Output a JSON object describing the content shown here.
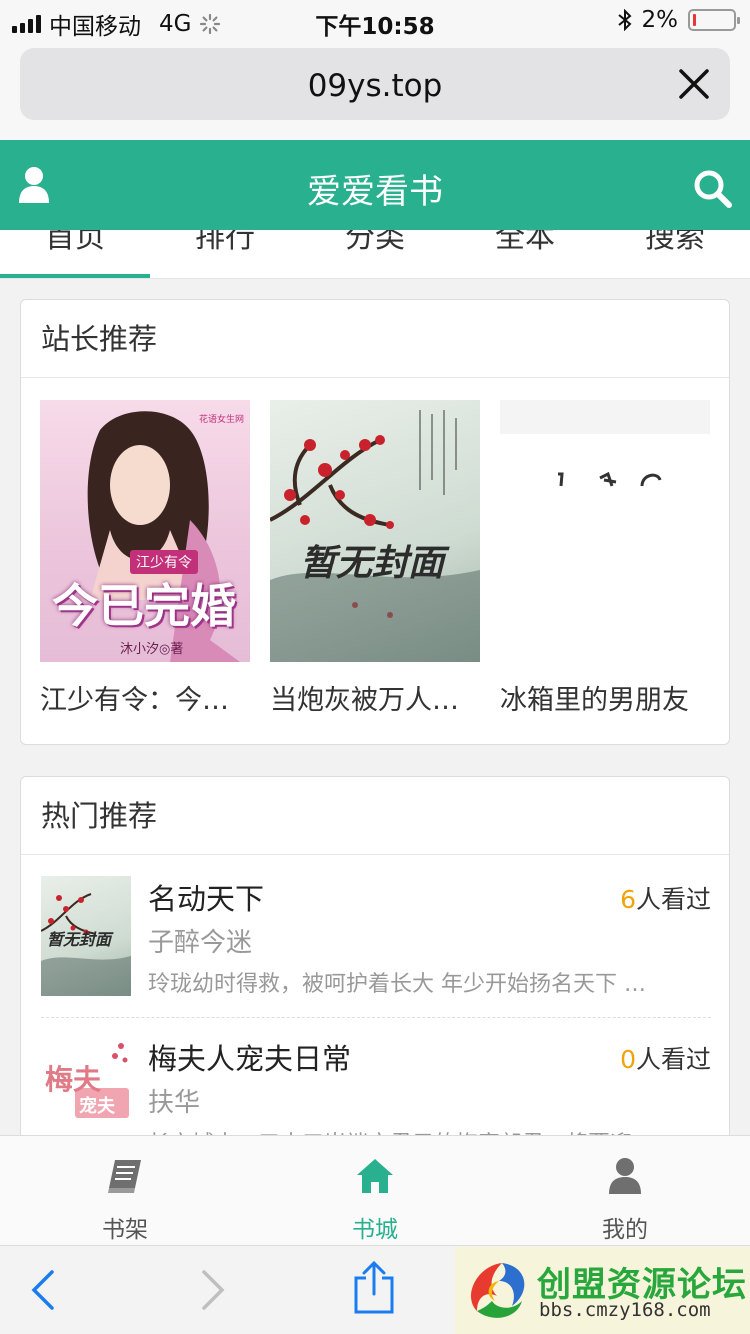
{
  "status_bar": {
    "carrier": "中国移动",
    "network": "4G",
    "time": "下午10:58",
    "battery": "2%"
  },
  "browser": {
    "url": "09ys.top"
  },
  "header": {
    "title": "爱爱看书"
  },
  "tabs": [
    {
      "label": "首页"
    },
    {
      "label": "排行"
    },
    {
      "label": "分类"
    },
    {
      "label": "全本"
    },
    {
      "label": "搜索"
    }
  ],
  "recommend": {
    "title": "站长推荐",
    "books": [
      {
        "name": "江少有令：今…",
        "cover_title": "今已完婚",
        "cover_subtitle": "江少有令",
        "cover_author": "沐小汐◎著",
        "cover_badge": "花语女生网"
      },
      {
        "name": "当炮灰被万人…",
        "cover_text": "暂无封面"
      },
      {
        "name": "冰箱里的男朋友"
      }
    ]
  },
  "hot": {
    "title": "热门推荐",
    "views_suffix": "人看过",
    "items": [
      {
        "title": "名动天下",
        "views": "6",
        "author": "子醉今迷",
        "desc": "玲珑幼时得救，被呵护着长大 年少开始扬名天下 …",
        "cover_text": "暂无封面"
      },
      {
        "title": "梅夫人宠夫日常",
        "views": "0",
        "author": "扶华",
        "desc": "长安城中，三十三岁端方君子的梅家郎君，将要迎",
        "cover_text_1": "梅夫",
        "cover_text_2": "宠夫"
      }
    ]
  },
  "bottom_nav": [
    {
      "label": "书架",
      "icon": "book-icon"
    },
    {
      "label": "书城",
      "icon": "home-icon",
      "active": true
    },
    {
      "label": "我的",
      "icon": "person-icon"
    }
  ],
  "watermark": {
    "title": "创盟资源论坛",
    "url": "bbs.cmzy168.com"
  },
  "colors": {
    "accent": "#29b08e",
    "views_number": "#f0a30a"
  }
}
